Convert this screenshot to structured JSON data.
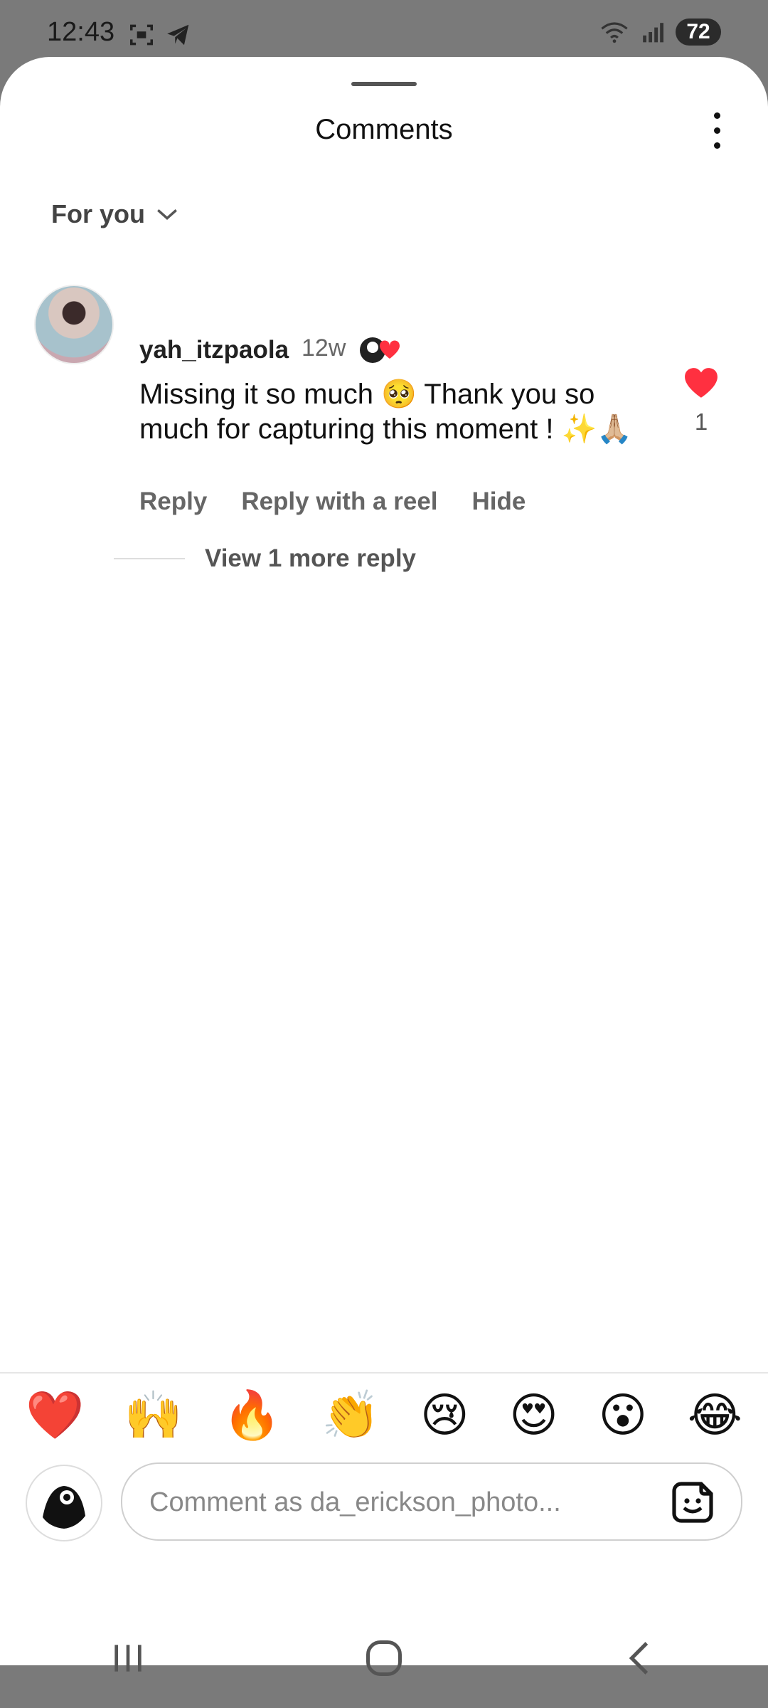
{
  "status_bar": {
    "time": "12:43",
    "battery": "72"
  },
  "sheet": {
    "title": "Comments",
    "sort_label": "For you"
  },
  "comment": {
    "username": "yah_itzpaola",
    "time": "12w",
    "text": "Missing it so much 🥺 Thank you so much for capturing this moment ! ✨🙏🏼",
    "like_count": "1",
    "actions": {
      "reply": "Reply",
      "reply_reel": "Reply with a reel",
      "hide": "Hide"
    },
    "view_replies": "View 1 more reply"
  },
  "quick_reactions": [
    "❤️",
    "🙌",
    "🔥",
    "👏",
    "😢",
    "😍",
    "😮",
    "😂"
  ],
  "composer": {
    "placeholder": "Comment as da_erickson_photo..."
  },
  "colors": {
    "like_red": "#ff3040",
    "text_gray": "#666666"
  }
}
